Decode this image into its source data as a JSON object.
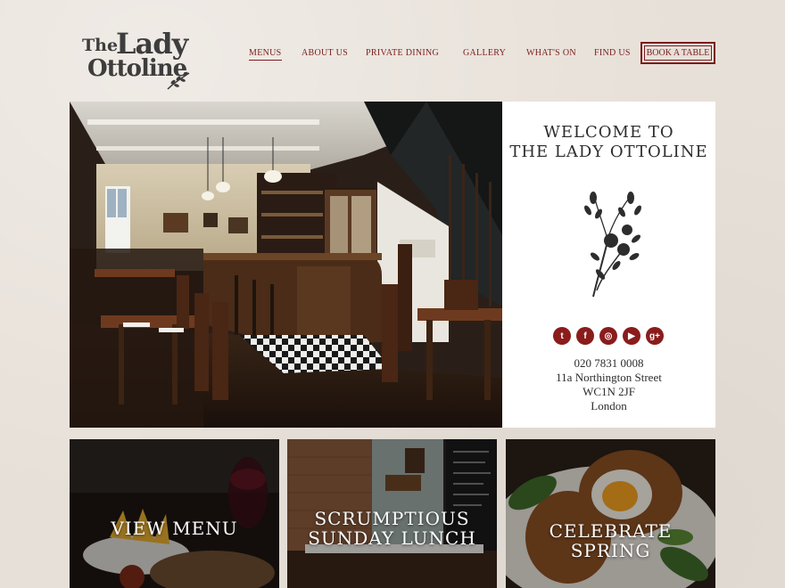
{
  "logo": {
    "the": "The",
    "lady": "Lady",
    "ottoline": "Ottoline"
  },
  "nav": {
    "items": [
      {
        "label": "MENUS",
        "active": true
      },
      {
        "label": "ABOUT US"
      },
      {
        "label": "PRIVATE DINING"
      },
      {
        "label": "GALLERY"
      },
      {
        "label": "WHAT'S ON"
      },
      {
        "label": "FIND US"
      }
    ],
    "book_label": "BOOK A TABLE"
  },
  "welcome": {
    "line1": "WELCOME TO",
    "line2": "THE LADY OTTOLINE",
    "socials": [
      {
        "icon": "twitter-icon",
        "glyph": "t"
      },
      {
        "icon": "facebook-icon",
        "glyph": "f"
      },
      {
        "icon": "instagram-icon",
        "glyph": "◎"
      },
      {
        "icon": "youtube-icon",
        "glyph": "▶"
      },
      {
        "icon": "google-plus-icon",
        "glyph": "g+"
      }
    ],
    "phone": "020 7831 0008",
    "street": "11a Northington Street",
    "postcode": "WC1N 2JF",
    "city": "London"
  },
  "cards": [
    {
      "line1": "VIEW MENU",
      "line2": ""
    },
    {
      "line1": "SCRUMPTIOUS",
      "line2": "SUNDAY LUNCH"
    },
    {
      "line1": "CELEBRATE",
      "line2": "SPRING"
    }
  ],
  "colors": {
    "accent": "#7b1d1d",
    "social": "#8a1c1c",
    "background": "#e7e0d8"
  }
}
